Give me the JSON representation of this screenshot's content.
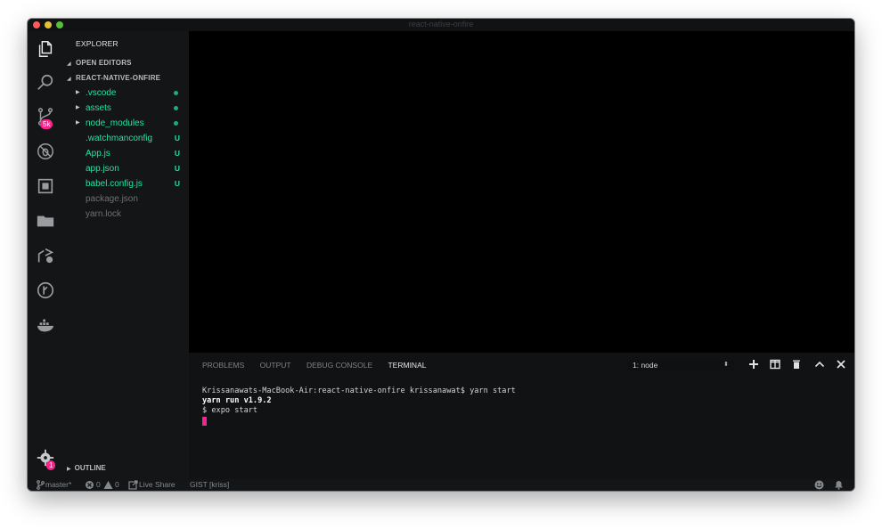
{
  "window": {
    "title": "react-native-onfire"
  },
  "activity_bar": {
    "items": [
      {
        "icon": "files-icon"
      },
      {
        "icon": "search-icon"
      },
      {
        "icon": "source-control-icon",
        "badge": "5k"
      },
      {
        "icon": "debug-icon"
      },
      {
        "icon": "extensions-icon"
      },
      {
        "icon": "folder-icon"
      },
      {
        "icon": "live-share-icon"
      },
      {
        "icon": "gitlens-icon"
      },
      {
        "icon": "docker-icon"
      }
    ],
    "settings": {
      "icon": "gear-icon",
      "badge": "1"
    }
  },
  "sidebar": {
    "title": "EXPLORER",
    "open_editors": "OPEN EDITORS",
    "project": "REACT-NATIVE-ONFIRE",
    "outline": "OUTLINE",
    "files": [
      {
        "name": ".vscode",
        "status": "",
        "folder": true
      },
      {
        "name": "assets",
        "status": "",
        "folder": true
      },
      {
        "name": "node_modules",
        "status": "",
        "folder": true
      },
      {
        "name": ".watchmanconfig",
        "status": "U"
      },
      {
        "name": "App.js",
        "status": "U"
      },
      {
        "name": "app.json",
        "status": "U"
      },
      {
        "name": "babel.config.js",
        "status": "U"
      },
      {
        "name": "package.json",
        "status": ""
      },
      {
        "name": "yarn.lock",
        "status": ""
      }
    ]
  },
  "panel": {
    "tabs": [
      "PROBLEMS",
      "OUTPUT",
      "DEBUG CONSOLE",
      "TERMINAL"
    ],
    "active_tab": "TERMINAL",
    "terminal_select": "1: node",
    "icons": [
      "plus-icon",
      "split-icon",
      "trash-icon",
      "chevron-up-icon",
      "close-icon"
    ],
    "terminal_lines": [
      "Krissanawats-MacBook-Air:react-native-onfire krissanawat$ yarn start",
      "yarn run v1.9.2",
      "$ expo start"
    ]
  },
  "statusbar": {
    "branch": "master*",
    "errors": "0",
    "warnings": "0",
    "live_share": "Live Share",
    "gist": "GIST [kriss]"
  }
}
